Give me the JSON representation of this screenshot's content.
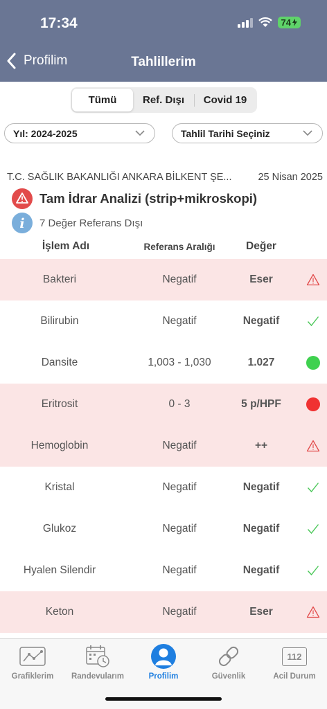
{
  "status_bar": {
    "time": "17:34",
    "battery": "74"
  },
  "nav": {
    "back_label": "Profilim",
    "title": "Tahlillerim"
  },
  "segments": [
    "Tümü",
    "Ref. Dışı",
    "Covid 19"
  ],
  "filters": {
    "year": "Yıl: 2024-2025",
    "date": "Tahlil Tarihi Seçiniz"
  },
  "lab": {
    "institution": "T.C. SAĞLIK BAKANLIĞI ANKARA BİLKENT ŞE...",
    "date": "25 Nisan 2025",
    "test_title": "Tam İdrar Analizi (strip+mikroskopi)",
    "out_of_range_text": "7 Değer Referans Dışı"
  },
  "table": {
    "headers": {
      "name": "İşlem Adı",
      "ref": "Referans Aralığı",
      "value": "Değer"
    },
    "rows": [
      {
        "name": "Bakteri",
        "ref": "Negatif",
        "value": "Eser",
        "status": "warning",
        "abnormal": true
      },
      {
        "name": "Bilirubin",
        "ref": "Negatif",
        "value": "Negatif",
        "status": "check",
        "abnormal": false
      },
      {
        "name": "Dansite",
        "ref": "1,003 - 1,030",
        "value": "1.027",
        "status": "green-dot",
        "abnormal": false
      },
      {
        "name": "Eritrosit",
        "ref": "0 - 3",
        "value": "5 p/HPF",
        "status": "red-dot",
        "abnormal": true
      },
      {
        "name": "Hemoglobin",
        "ref": "Negatif",
        "value": "++",
        "status": "warning",
        "abnormal": true
      },
      {
        "name": "Kristal",
        "ref": "Negatif",
        "value": "Negatif",
        "status": "check",
        "abnormal": false
      },
      {
        "name": "Glukoz",
        "ref": "Negatif",
        "value": "Negatif",
        "status": "check",
        "abnormal": false
      },
      {
        "name": "Hyalen Silendir",
        "ref": "Negatif",
        "value": "Negatif",
        "status": "check",
        "abnormal": false
      },
      {
        "name": "Keton",
        "ref": "Negatif",
        "value": "Eser",
        "status": "warning",
        "abnormal": true
      }
    ]
  },
  "tabs": [
    {
      "label": "Grafiklerim",
      "icon": "chart-icon",
      "active": false
    },
    {
      "label": "Randevularım",
      "icon": "calendar-clock-icon",
      "active": false
    },
    {
      "label": "Profilim",
      "icon": "person-icon",
      "active": true
    },
    {
      "label": "Güvenlik",
      "icon": "chain-link-icon",
      "active": false
    },
    {
      "label": "Acil Durum",
      "icon": "emergency-112-icon",
      "active": false,
      "icon_text": "112"
    }
  ],
  "colors": {
    "header_bg": "#6a7694",
    "abnormal_row_bg": "#fbe5e5",
    "warning_red": "#e24b4b",
    "check_green": "#4cc85a",
    "ok_dot": "#3fd14f",
    "alert_dot": "#f03232",
    "info_blue": "#7aaedb",
    "active_tab": "#1f7fe0"
  }
}
